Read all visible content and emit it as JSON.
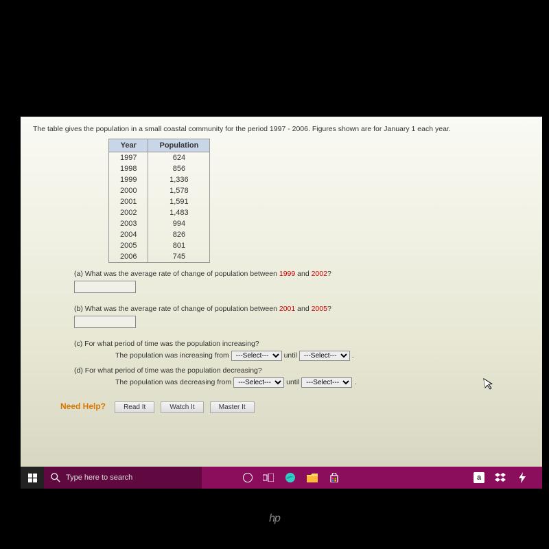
{
  "problem": {
    "intro": "The table gives the population in a small coastal community for the period 1997 - 2006. Figures shown are for January 1 each year.",
    "table": {
      "headers": [
        "Year",
        "Population"
      ],
      "rows": [
        [
          "1997",
          "624"
        ],
        [
          "1998",
          "856"
        ],
        [
          "1999",
          "1,336"
        ],
        [
          "2000",
          "1,578"
        ],
        [
          "2001",
          "1,591"
        ],
        [
          "2002",
          "1,483"
        ],
        [
          "2003",
          "994"
        ],
        [
          "2004",
          "826"
        ],
        [
          "2005",
          "801"
        ],
        [
          "2006",
          "745"
        ]
      ]
    },
    "qa": {
      "prefix": "(a) What was the average rate of change of population between ",
      "y1": "1999",
      "and": " and ",
      "y2": "2002",
      "suffix": "?"
    },
    "qb": {
      "prefix": "(b) What was the average rate of change of population between ",
      "y1": "2001",
      "and": " and ",
      "y2": "2005",
      "suffix": "?"
    },
    "qc": {
      "text": "(c) For what period of time was the population increasing?",
      "line_prefix": "The population was increasing from ",
      "until": " until ",
      "select_placeholder": "---Select---",
      "period": "."
    },
    "qd": {
      "text": "(d) For what period of time was the population decreasing?",
      "line_prefix": "The population was decreasing from ",
      "until": " until ",
      "select_placeholder": "---Select---",
      "period": "."
    }
  },
  "help": {
    "label": "Need Help?",
    "read": "Read It",
    "watch": "Watch It",
    "master": "Master It"
  },
  "taskbar": {
    "search_placeholder": "Type here to search"
  },
  "brand": "hp"
}
